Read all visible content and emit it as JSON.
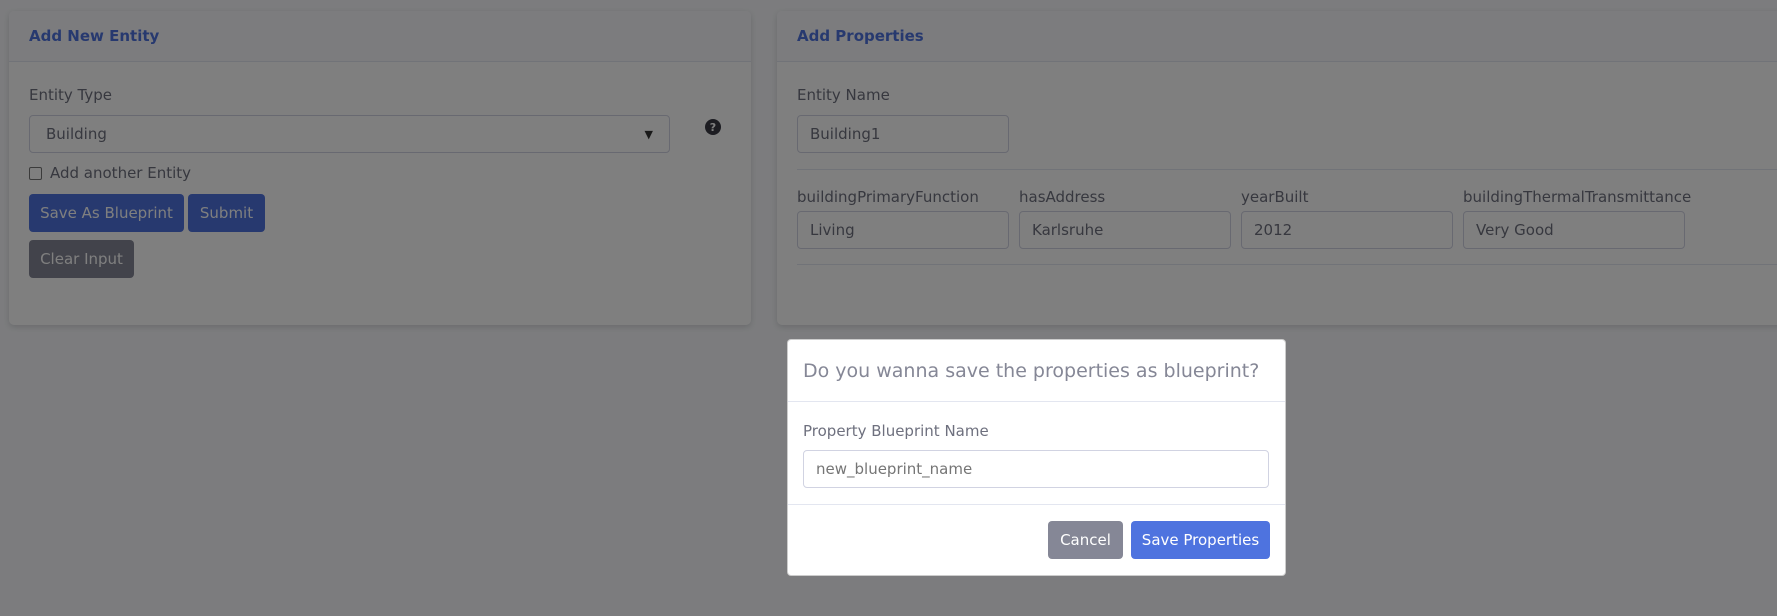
{
  "left_card": {
    "title": "Add New Entity",
    "entity_type_label": "Entity Type",
    "entity_type_value": "Building",
    "help_icon": "question-circle-icon",
    "add_another_label": "Add another Entity",
    "save_blueprint_label": "Save As Blueprint",
    "submit_label": "Submit",
    "clear_input_label": "Clear Input"
  },
  "right_card": {
    "title": "Add Properties",
    "entity_name_label": "Entity Name",
    "entity_name_value": "Building1",
    "properties": [
      {
        "label": "buildingPrimaryFunction",
        "value": "Living"
      },
      {
        "label": "hasAddress",
        "value": "Karlsruhe"
      },
      {
        "label": "yearBuilt",
        "value": "2012"
      },
      {
        "label": "buildingThermalTransmittance",
        "value": "Very Good"
      }
    ]
  },
  "modal": {
    "title": "Do you wanna save the properties as blueprint?",
    "field_label": "Property Blueprint Name",
    "field_placeholder": "new_blueprint_name",
    "cancel_label": "Cancel",
    "save_label": "Save Properties"
  },
  "colors": {
    "primary": "#4e73df",
    "secondary": "#858796",
    "overlay": "rgba(0,0,0,0.5)"
  }
}
